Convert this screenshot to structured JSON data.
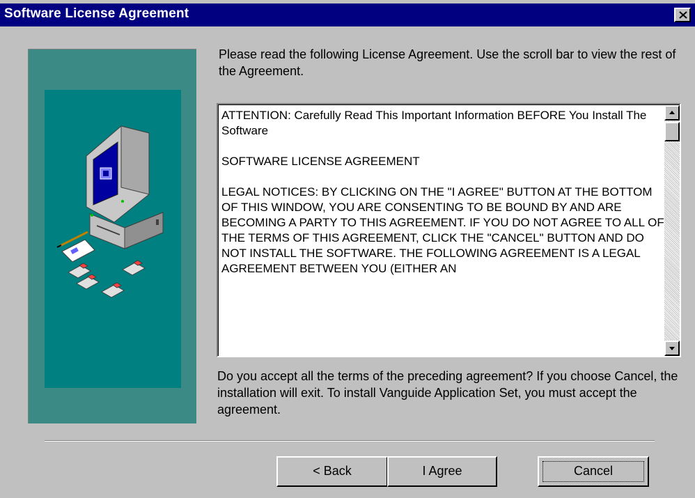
{
  "window": {
    "title": "Software License Agreement"
  },
  "instructions": "Please read the following License Agreement. Use the scroll bar to view the rest of the Agreement.",
  "license": {
    "paragraphs": [
      "ATTENTION:  Carefully Read This Important Information BEFORE You Install The Software",
      "SOFTWARE LICENSE AGREEMENT",
      "LEGAL NOTICES: BY CLICKING ON THE \"I AGREE\" BUTTON AT THE BOTTOM OF THIS WINDOW, YOU ARE CONSENTING TO BE BOUND BY AND ARE BECOMING A PARTY TO THIS AGREEMENT.  IF YOU DO NOT AGREE TO ALL OF THE TERMS OF THIS AGREEMENT, CLICK THE \"CANCEL\" BUTTON AND DO NOT INSTALL THE SOFTWARE. THE FOLLOWING AGREEMENT IS A LEGAL AGREEMENT BETWEEN YOU (EITHER AN"
    ]
  },
  "question": "Do you accept all the terms of the preceding agreement? If you choose Cancel, the installation will exit. To install Vanguide Application Set, you must accept the agreement.",
  "buttons": {
    "back": "< Back",
    "agree": "I Agree",
    "cancel": "Cancel"
  },
  "icons": {
    "close": "close-icon",
    "illustration": "computer-install-illustration",
    "scroll_up": "scroll-up-arrow-icon",
    "scroll_down": "scroll-down-arrow-icon"
  },
  "colors": {
    "titlebar": "#000080",
    "panel": "#3c8a86",
    "panel_inner": "#008080",
    "face": "#c0c0c0"
  }
}
